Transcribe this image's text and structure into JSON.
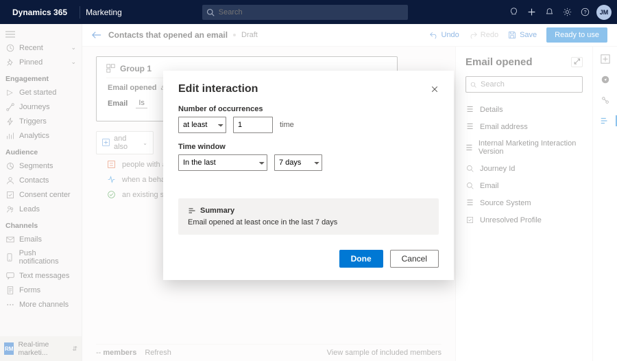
{
  "topbar": {
    "brand": "Dynamics 365",
    "app": "Marketing",
    "search_placeholder": "Search",
    "avatar": "JM"
  },
  "leftnav": {
    "recent": "Recent",
    "pinned": "Pinned",
    "sections": {
      "engagement": "Engagement",
      "audience": "Audience",
      "channels": "Channels"
    },
    "items": {
      "get_started": "Get started",
      "journeys": "Journeys",
      "triggers": "Triggers",
      "analytics": "Analytics",
      "segments": "Segments",
      "contacts": "Contacts",
      "consent": "Consent center",
      "leads": "Leads",
      "emails": "Emails",
      "push": "Push notifications",
      "texts": "Text messages",
      "forms": "Forms",
      "more_channels": "More channels"
    },
    "footer": {
      "badge": "RM",
      "label": "Real-time marketi..."
    }
  },
  "header": {
    "title": "Contacts that opened an email",
    "status": "Draft",
    "undo": "Undo",
    "redo": "Redo",
    "save": "Save",
    "ready": "Ready to use"
  },
  "canvas": {
    "group_title": "Group 1",
    "email_opened_label": "Email opened",
    "at_least_prefix": "at le",
    "tab_email": "Email",
    "tab_is": "Is",
    "and_also": "and also",
    "s1": "people with a sp",
    "s2": "when a behavio",
    "s3": "an existing segm",
    "members_prefix": "--",
    "members_label": "members",
    "refresh": "Refresh",
    "sample": "View sample of included members"
  },
  "rightpane": {
    "title": "Email opened",
    "search_placeholder": "Search",
    "attrs": [
      "Details",
      "Email address",
      "Internal Marketing Interaction Version",
      "Journey Id",
      "Email",
      "Source System",
      "Unresolved Profile"
    ]
  },
  "modal": {
    "title": "Edit interaction",
    "occur_label": "Number of occurrences",
    "occur_op": "at least",
    "occur_val": "1",
    "occur_unit": "time",
    "tw_label": "Time window",
    "tw_op": "In the last",
    "tw_val": "7 days",
    "summary_title": "Summary",
    "summary_text": "Email opened at least once in the last 7 days",
    "done": "Done",
    "cancel": "Cancel"
  }
}
